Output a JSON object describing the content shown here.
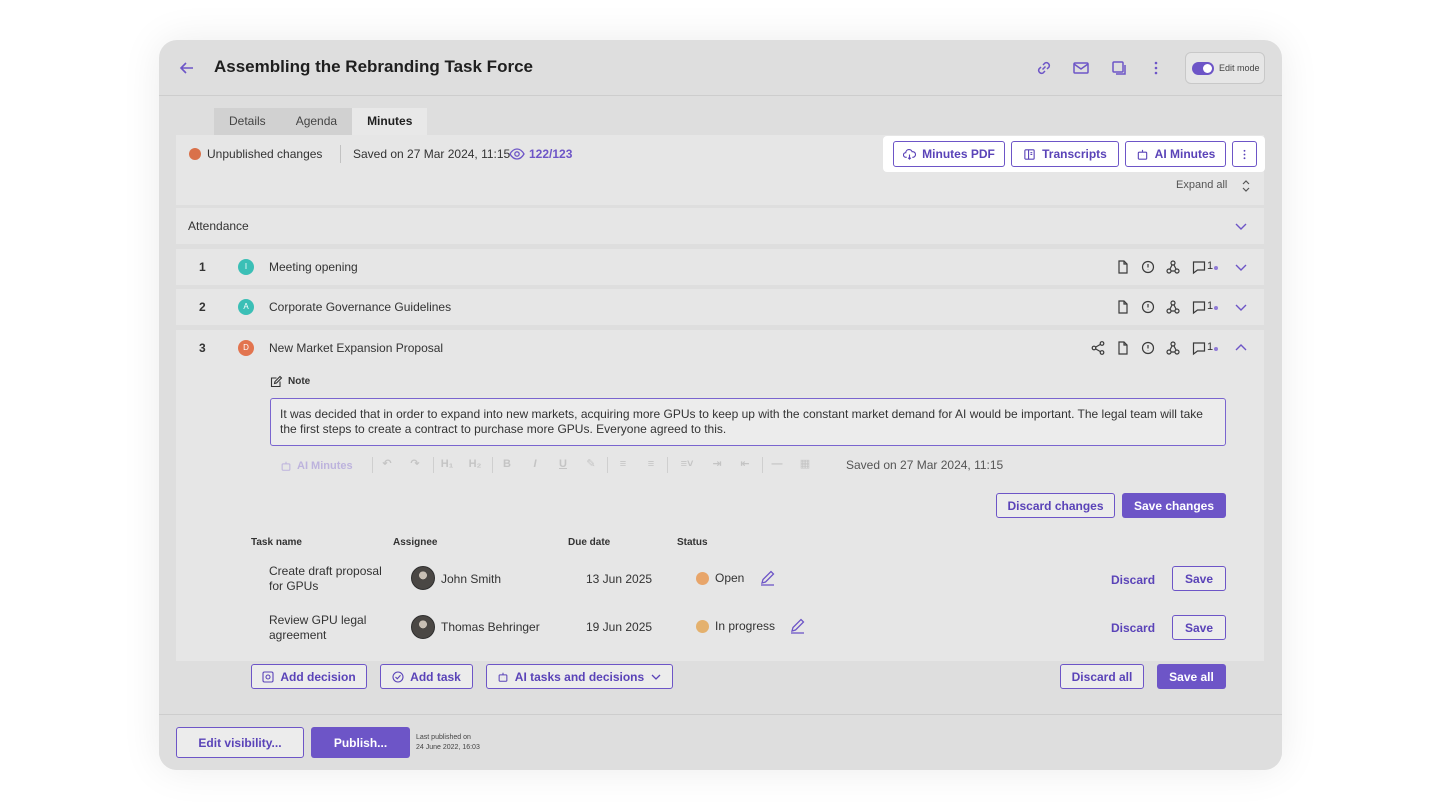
{
  "header": {
    "title": "Assembling the Rebranding Task Force",
    "edit_mode_label": "Edit mode"
  },
  "tabs": [
    {
      "label": "Details"
    },
    {
      "label": "Agenda"
    },
    {
      "label": "Minutes"
    }
  ],
  "status": {
    "unpublished": "Unpublished changes",
    "saved": "Saved on 27 Mar 2024, 11:15",
    "views": "122/123"
  },
  "actions": {
    "minutes_pdf": "Minutes PDF",
    "transcripts": "Transcripts",
    "ai_minutes": "AI Minutes",
    "expand_all": "Expand all"
  },
  "attendance": {
    "label": "Attendance"
  },
  "agenda_items": [
    {
      "number": "1",
      "initial": "I",
      "avatar_color": "#3bbfb6",
      "title": "Meeting opening",
      "comment_count": "1"
    },
    {
      "number": "2",
      "initial": "A",
      "avatar_color": "#3bbfb6",
      "title": "Corporate Governance Guidelines",
      "comment_count": "1"
    },
    {
      "number": "3",
      "initial": "D",
      "avatar_color": "#e2744f",
      "title": "New Market Expansion Proposal",
      "comment_count": "1"
    }
  ],
  "note": {
    "label": "Note",
    "text": "It was decided that in order to expand into new markets, acquiring more GPUs to keep up with the constant market demand for AI would be important. The legal team will take the first steps to create a contract to purchase more GPUs. Everyone agreed to this.",
    "toolbar_ai": "AI Minutes",
    "saved": "Saved on 27 Mar 2024, 11:15",
    "discard_changes": "Discard changes",
    "save_changes": "Save changes"
  },
  "tasks_table": {
    "headers": {
      "name": "Task name",
      "assignee": "Assignee",
      "due": "Due date",
      "status": "Status"
    },
    "rows": [
      {
        "name_line1": "Create draft proposal",
        "name_line2": "for GPUs",
        "assignee": "John Smith",
        "due": "13 Jun 2025",
        "status": "Open",
        "status_color": "#e8a56a",
        "discard": "Discard",
        "save": "Save"
      },
      {
        "name_line1": "Review GPU legal",
        "name_line2": "agreement",
        "assignee": "Thomas Behringer",
        "due": "19 Jun 2025",
        "status": "In progress",
        "status_color": "#e4b16e",
        "discard": "Discard",
        "save": "Save"
      }
    ]
  },
  "item_actions": {
    "add_decision": "Add decision",
    "add_task": "Add task",
    "ai_tasks": "AI tasks and decisions",
    "discard_all": "Discard all",
    "save_all": "Save all"
  },
  "footer": {
    "edit_visibility": "Edit visibility...",
    "publish": "Publish...",
    "last_published_line1": "Last published on",
    "last_published_line2": "24 June 2022, 16:03"
  },
  "colors": {
    "accent": "#6d55c7",
    "unpublished_dot": "#d9714a"
  }
}
